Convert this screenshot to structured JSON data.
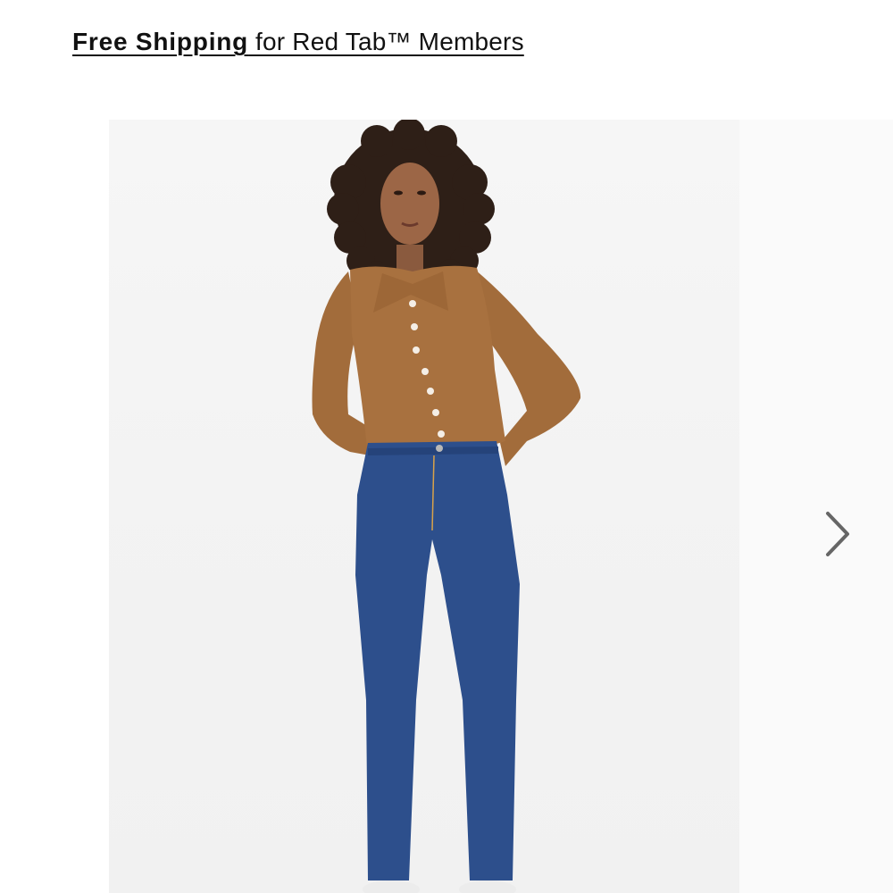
{
  "promo": {
    "strong": "Free Shipping",
    "rest": " for Red Tab™ Members"
  },
  "gallery": {
    "image_subject": "model-wearing-brown-knit-polo-cardigan-and-blue-straight-jeans",
    "next_icon": "chevron-right-icon"
  },
  "colors": {
    "text": "#111111",
    "background": "#ffffff",
    "photo_bg": "#f4f4f4",
    "sweater": "#a8713f",
    "denim": "#2d4f8c",
    "arrow": "#666666"
  }
}
